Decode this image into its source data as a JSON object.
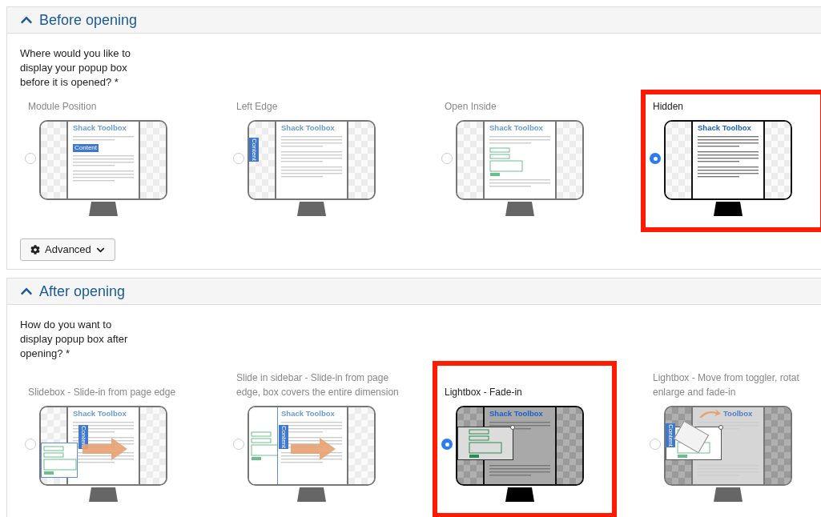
{
  "sections": [
    {
      "title": "Before opening",
      "expanded": true,
      "question": "Where would you like to display your popup box before it is opened? *",
      "options": [
        {
          "kind": "module",
          "label_lines": [
            "Module Position"
          ],
          "screen_title": "Shack Toolbox",
          "tab_label": "Content",
          "selected": false
        },
        {
          "kind": "left",
          "label_lines": [
            "Left Edge"
          ],
          "screen_title": "Shack Toolbox",
          "tab_label": "Content",
          "selected": false
        },
        {
          "kind": "inside",
          "label_lines": [
            "Open Inside"
          ],
          "screen_title": "Shack Toolbox",
          "selected": false
        },
        {
          "kind": "hidden",
          "label_lines": [
            "Hidden"
          ],
          "screen_title": "Shack Toolbox",
          "selected": true
        }
      ],
      "advanced_button": "Advanced"
    },
    {
      "title": "After opening",
      "expanded": true,
      "question": "How do you want to display popup box after opening? *",
      "options": [
        {
          "kind": "slidebox",
          "label_lines": [
            "Slidebox - Slide-in from page edge"
          ],
          "screen_title": "Shack Toolbox",
          "tab_label": "Content",
          "selected": false
        },
        {
          "kind": "sidebar",
          "label_lines": [
            "Slide in sidebar - Slide-in from page",
            "edge, box covers the entire dimension"
          ],
          "screen_title": "Shack Toolbox",
          "tab_label": "Content",
          "selected": false
        },
        {
          "kind": "fade",
          "label_lines": [
            "Lightbox - Fade-in"
          ],
          "screen_title": "Shack Toolbox",
          "selected": true
        },
        {
          "kind": "move",
          "label_lines": [
            "Lightbox - Move from toggler, rotat",
            "enlarge and fade-in"
          ],
          "screen_title": "Toolbox",
          "tab_label": "Content",
          "selected": false
        }
      ]
    }
  ]
}
